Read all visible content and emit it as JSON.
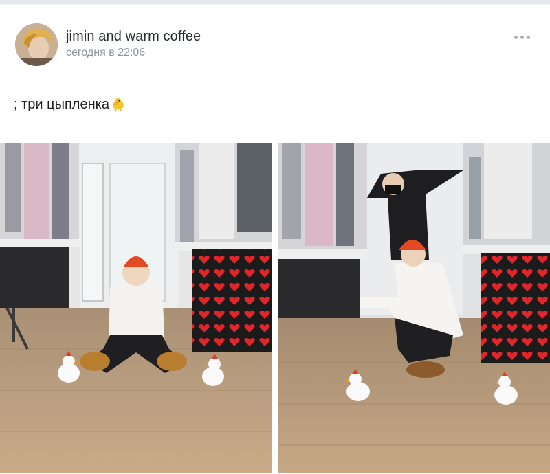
{
  "post": {
    "author": "jimin and warm coffee",
    "time": "сегодня в 22:06",
    "text": "; три цыпленка"
  },
  "icons": {
    "more": "more-horizontal-icon",
    "emoji": "baby-chick-emoji"
  },
  "colors": {
    "author_text": "#2a2d33",
    "meta_text": "#8e949c",
    "body_text": "#1f2125",
    "divider": "#e6e9ee",
    "menu_dots": "#a9aeb5"
  }
}
